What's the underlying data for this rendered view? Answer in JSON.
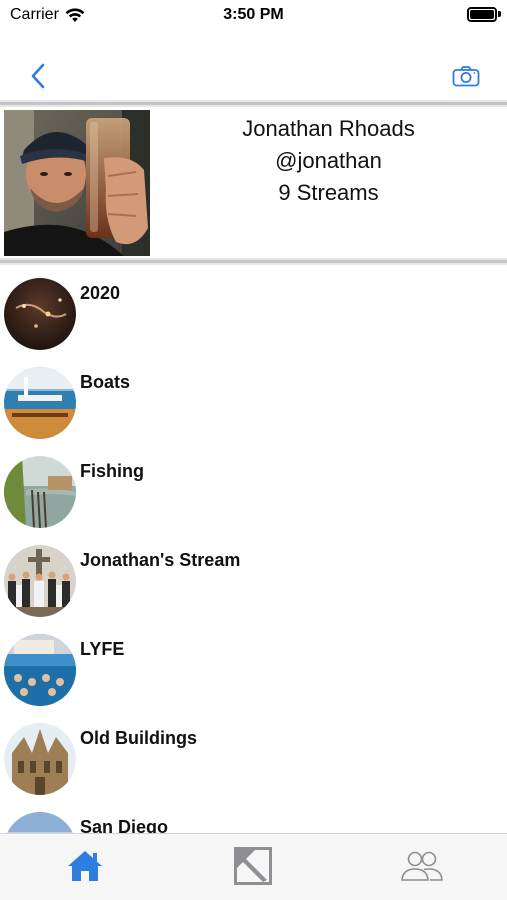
{
  "status_bar": {
    "carrier": "Carrier",
    "time": "3:50 PM",
    "wifi_icon": "wifi-icon",
    "battery_icon": "battery-icon"
  },
  "nav": {
    "back_icon": "chevron-left-icon",
    "camera_icon": "camera-icon",
    "accent_color": "#2f7ddf"
  },
  "profile": {
    "name": "Jonathan Rhoads",
    "handle": "@jonathan",
    "streams": "9 Streams"
  },
  "streams": [
    {
      "name": "2020"
    },
    {
      "name": "Boats"
    },
    {
      "name": "Fishing"
    },
    {
      "name": "Jonathan's Stream"
    },
    {
      "name": "LYFE"
    },
    {
      "name": "Old Buildings"
    },
    {
      "name": "San Diego"
    }
  ],
  "tab_bar": {
    "home_icon": "home-icon",
    "post_icon": "image-post-icon",
    "people_icon": "people-icon",
    "active_color": "#2f7ddf",
    "inactive_color": "#8e8e93"
  }
}
